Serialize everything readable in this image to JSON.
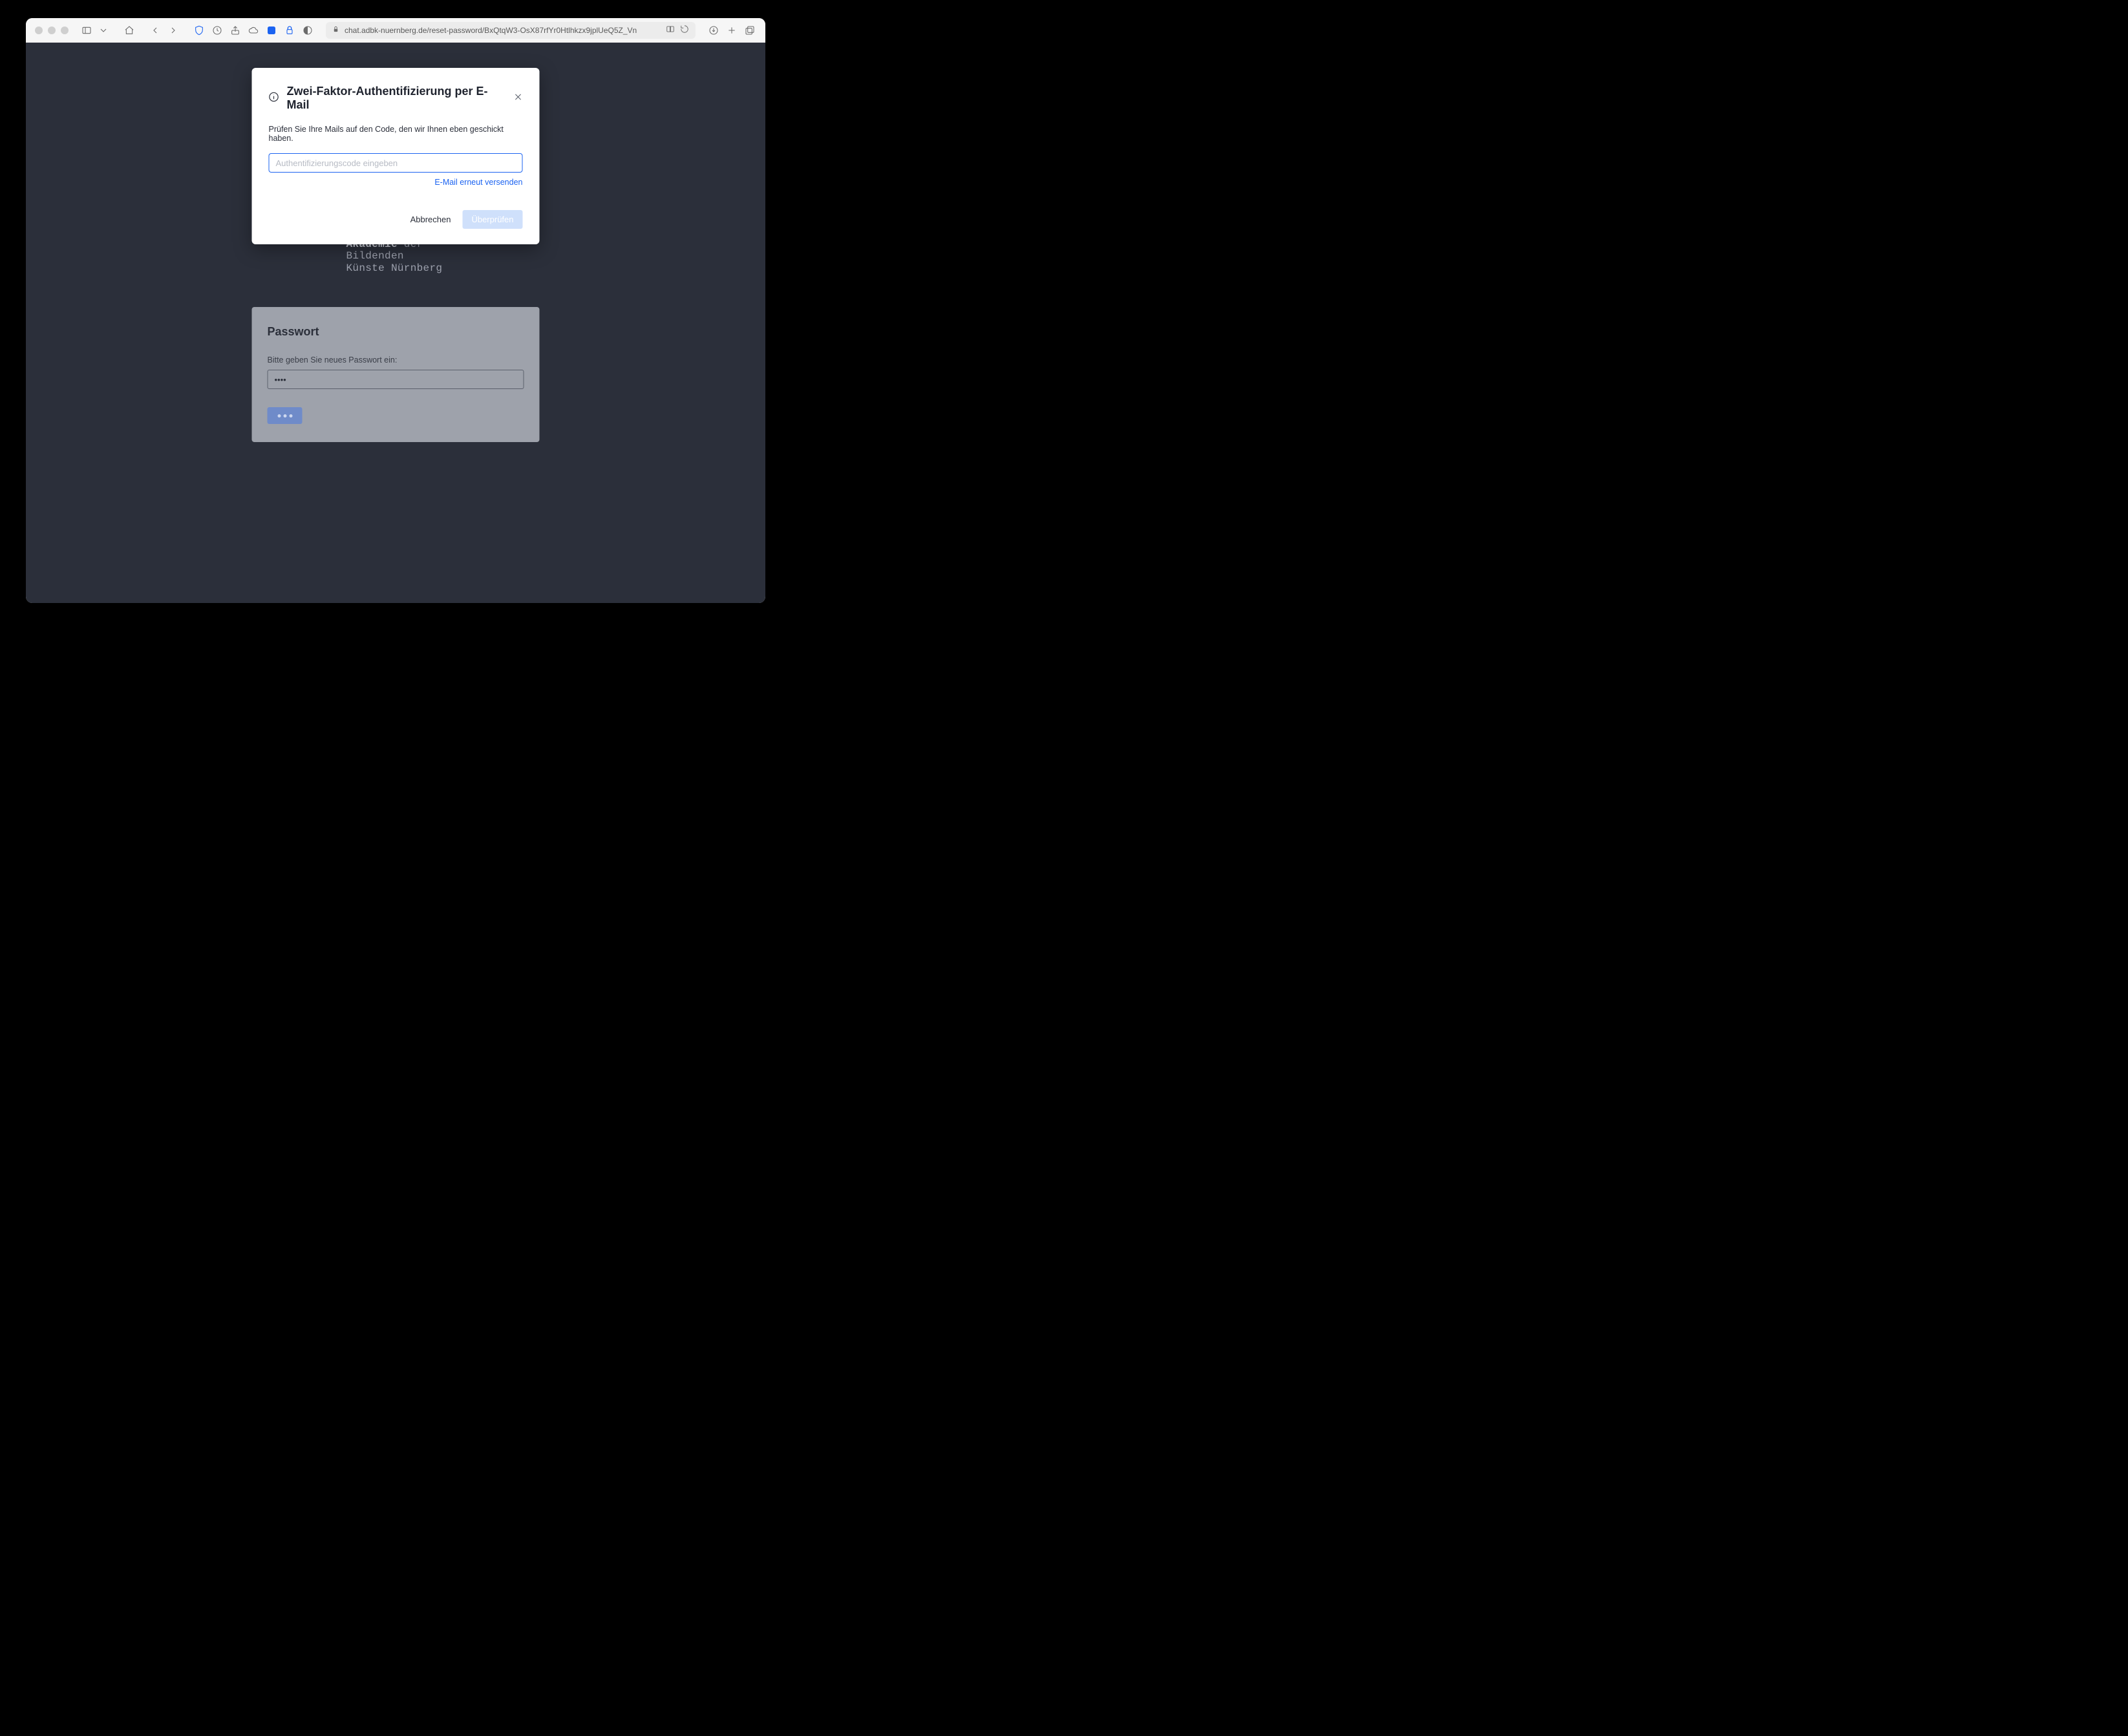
{
  "browser": {
    "url": "chat.adbk-nuernberg.de/reset-password/BxQtqW3-OsX87rfYr0Htlhkzx9jplUeQ5Z_Vn"
  },
  "logo": {
    "l1a": "Akademie",
    "l1b": " der",
    "l2": "Bildenden",
    "l3": "Künste Nürnberg"
  },
  "password_card": {
    "title": "Passwort",
    "label": "Bitte geben Sie neues Passwort ein:",
    "value": "••••"
  },
  "modal": {
    "title": "Zwei-Faktor-Authentifizierung per E-Mail",
    "body": "Prüfen Sie Ihre Mails auf den Code, den wir Ihnen eben geschickt haben.",
    "placeholder": "Authentifizierungscode eingeben",
    "resend": "E-Mail erneut versenden",
    "cancel": "Abbrechen",
    "verify": "Überprüfen"
  }
}
